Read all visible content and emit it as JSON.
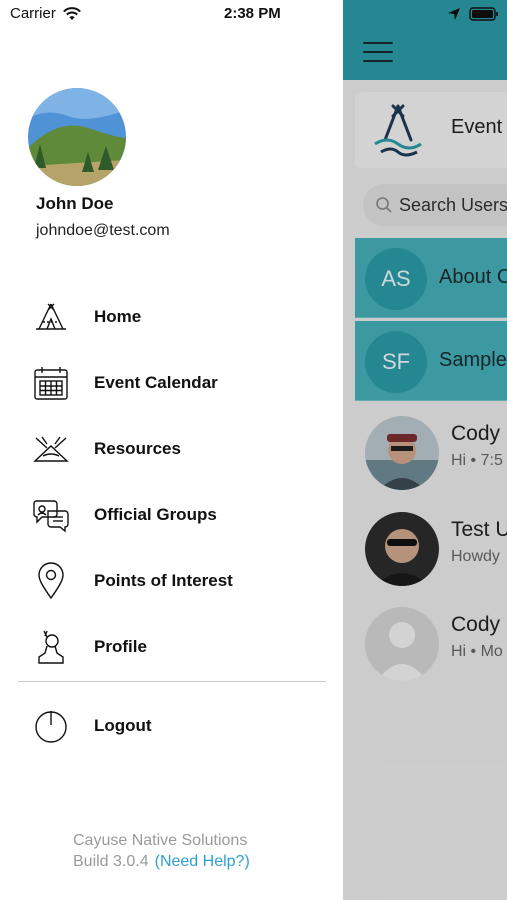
{
  "status_bar": {
    "carrier": "Carrier",
    "time": "2:38 PM"
  },
  "drawer": {
    "user": {
      "name": "John Doe",
      "email": "johndoe@test.com"
    },
    "menu": [
      {
        "label": "Home",
        "icon": "tent-icon"
      },
      {
        "label": "Event Calendar",
        "icon": "calendar-icon"
      },
      {
        "label": "Resources",
        "icon": "resources-icon"
      },
      {
        "label": "Official Groups",
        "icon": "chat-bubbles-icon"
      },
      {
        "label": "Points of Interest",
        "icon": "map-pin-icon"
      },
      {
        "label": "Profile",
        "icon": "person-icon"
      },
      {
        "label": "Logout",
        "icon": "power-icon"
      }
    ],
    "footer": {
      "company": "Cayuse Native Solutions",
      "build": "Build 3.0.4",
      "help": "(Need Help?)"
    }
  },
  "background_app": {
    "header_title": "Event",
    "search_placeholder": "Search Users",
    "groups": [
      {
        "initials": "AS",
        "name": "About C"
      },
      {
        "initials": "SF",
        "name": "Sample"
      }
    ],
    "messages": [
      {
        "name": "Cody",
        "preview": "Hi • 7:5"
      },
      {
        "name": "Test U",
        "preview": "Howdy"
      },
      {
        "name": "Cody",
        "preview": "Hi • Mo"
      }
    ]
  },
  "colors": {
    "accent_teal": "#2a9aa5",
    "group_row": "#45afb8",
    "help_link": "#2f9fd0"
  }
}
